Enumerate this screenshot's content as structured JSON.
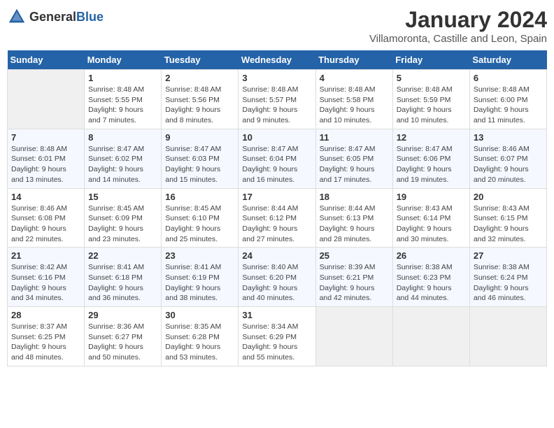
{
  "header": {
    "logo_general": "General",
    "logo_blue": "Blue",
    "title": "January 2024",
    "subtitle": "Villamoronta, Castille and Leon, Spain"
  },
  "calendar": {
    "days_of_week": [
      "Sunday",
      "Monday",
      "Tuesday",
      "Wednesday",
      "Thursday",
      "Friday",
      "Saturday"
    ],
    "weeks": [
      [
        {
          "day": "",
          "empty": true
        },
        {
          "day": "1",
          "sunrise": "Sunrise: 8:48 AM",
          "sunset": "Sunset: 5:55 PM",
          "daylight": "Daylight: 9 hours and 7 minutes."
        },
        {
          "day": "2",
          "sunrise": "Sunrise: 8:48 AM",
          "sunset": "Sunset: 5:56 PM",
          "daylight": "Daylight: 9 hours and 8 minutes."
        },
        {
          "day": "3",
          "sunrise": "Sunrise: 8:48 AM",
          "sunset": "Sunset: 5:57 PM",
          "daylight": "Daylight: 9 hours and 9 minutes."
        },
        {
          "day": "4",
          "sunrise": "Sunrise: 8:48 AM",
          "sunset": "Sunset: 5:58 PM",
          "daylight": "Daylight: 9 hours and 10 minutes."
        },
        {
          "day": "5",
          "sunrise": "Sunrise: 8:48 AM",
          "sunset": "Sunset: 5:59 PM",
          "daylight": "Daylight: 9 hours and 10 minutes."
        },
        {
          "day": "6",
          "sunrise": "Sunrise: 8:48 AM",
          "sunset": "Sunset: 6:00 PM",
          "daylight": "Daylight: 9 hours and 11 minutes."
        }
      ],
      [
        {
          "day": "7",
          "sunrise": "Sunrise: 8:48 AM",
          "sunset": "Sunset: 6:01 PM",
          "daylight": "Daylight: 9 hours and 13 minutes."
        },
        {
          "day": "8",
          "sunrise": "Sunrise: 8:47 AM",
          "sunset": "Sunset: 6:02 PM",
          "daylight": "Daylight: 9 hours and 14 minutes."
        },
        {
          "day": "9",
          "sunrise": "Sunrise: 8:47 AM",
          "sunset": "Sunset: 6:03 PM",
          "daylight": "Daylight: 9 hours and 15 minutes."
        },
        {
          "day": "10",
          "sunrise": "Sunrise: 8:47 AM",
          "sunset": "Sunset: 6:04 PM",
          "daylight": "Daylight: 9 hours and 16 minutes."
        },
        {
          "day": "11",
          "sunrise": "Sunrise: 8:47 AM",
          "sunset": "Sunset: 6:05 PM",
          "daylight": "Daylight: 9 hours and 17 minutes."
        },
        {
          "day": "12",
          "sunrise": "Sunrise: 8:47 AM",
          "sunset": "Sunset: 6:06 PM",
          "daylight": "Daylight: 9 hours and 19 minutes."
        },
        {
          "day": "13",
          "sunrise": "Sunrise: 8:46 AM",
          "sunset": "Sunset: 6:07 PM",
          "daylight": "Daylight: 9 hours and 20 minutes."
        }
      ],
      [
        {
          "day": "14",
          "sunrise": "Sunrise: 8:46 AM",
          "sunset": "Sunset: 6:08 PM",
          "daylight": "Daylight: 9 hours and 22 minutes."
        },
        {
          "day": "15",
          "sunrise": "Sunrise: 8:45 AM",
          "sunset": "Sunset: 6:09 PM",
          "daylight": "Daylight: 9 hours and 23 minutes."
        },
        {
          "day": "16",
          "sunrise": "Sunrise: 8:45 AM",
          "sunset": "Sunset: 6:10 PM",
          "daylight": "Daylight: 9 hours and 25 minutes."
        },
        {
          "day": "17",
          "sunrise": "Sunrise: 8:44 AM",
          "sunset": "Sunset: 6:12 PM",
          "daylight": "Daylight: 9 hours and 27 minutes."
        },
        {
          "day": "18",
          "sunrise": "Sunrise: 8:44 AM",
          "sunset": "Sunset: 6:13 PM",
          "daylight": "Daylight: 9 hours and 28 minutes."
        },
        {
          "day": "19",
          "sunrise": "Sunrise: 8:43 AM",
          "sunset": "Sunset: 6:14 PM",
          "daylight": "Daylight: 9 hours and 30 minutes."
        },
        {
          "day": "20",
          "sunrise": "Sunrise: 8:43 AM",
          "sunset": "Sunset: 6:15 PM",
          "daylight": "Daylight: 9 hours and 32 minutes."
        }
      ],
      [
        {
          "day": "21",
          "sunrise": "Sunrise: 8:42 AM",
          "sunset": "Sunset: 6:16 PM",
          "daylight": "Daylight: 9 hours and 34 minutes."
        },
        {
          "day": "22",
          "sunrise": "Sunrise: 8:41 AM",
          "sunset": "Sunset: 6:18 PM",
          "daylight": "Daylight: 9 hours and 36 minutes."
        },
        {
          "day": "23",
          "sunrise": "Sunrise: 8:41 AM",
          "sunset": "Sunset: 6:19 PM",
          "daylight": "Daylight: 9 hours and 38 minutes."
        },
        {
          "day": "24",
          "sunrise": "Sunrise: 8:40 AM",
          "sunset": "Sunset: 6:20 PM",
          "daylight": "Daylight: 9 hours and 40 minutes."
        },
        {
          "day": "25",
          "sunrise": "Sunrise: 8:39 AM",
          "sunset": "Sunset: 6:21 PM",
          "daylight": "Daylight: 9 hours and 42 minutes."
        },
        {
          "day": "26",
          "sunrise": "Sunrise: 8:38 AM",
          "sunset": "Sunset: 6:23 PM",
          "daylight": "Daylight: 9 hours and 44 minutes."
        },
        {
          "day": "27",
          "sunrise": "Sunrise: 8:38 AM",
          "sunset": "Sunset: 6:24 PM",
          "daylight": "Daylight: 9 hours and 46 minutes."
        }
      ],
      [
        {
          "day": "28",
          "sunrise": "Sunrise: 8:37 AM",
          "sunset": "Sunset: 6:25 PM",
          "daylight": "Daylight: 9 hours and 48 minutes."
        },
        {
          "day": "29",
          "sunrise": "Sunrise: 8:36 AM",
          "sunset": "Sunset: 6:27 PM",
          "daylight": "Daylight: 9 hours and 50 minutes."
        },
        {
          "day": "30",
          "sunrise": "Sunrise: 8:35 AM",
          "sunset": "Sunset: 6:28 PM",
          "daylight": "Daylight: 9 hours and 53 minutes."
        },
        {
          "day": "31",
          "sunrise": "Sunrise: 8:34 AM",
          "sunset": "Sunset: 6:29 PM",
          "daylight": "Daylight: 9 hours and 55 minutes."
        },
        {
          "day": "",
          "empty": true
        },
        {
          "day": "",
          "empty": true
        },
        {
          "day": "",
          "empty": true
        }
      ]
    ]
  }
}
